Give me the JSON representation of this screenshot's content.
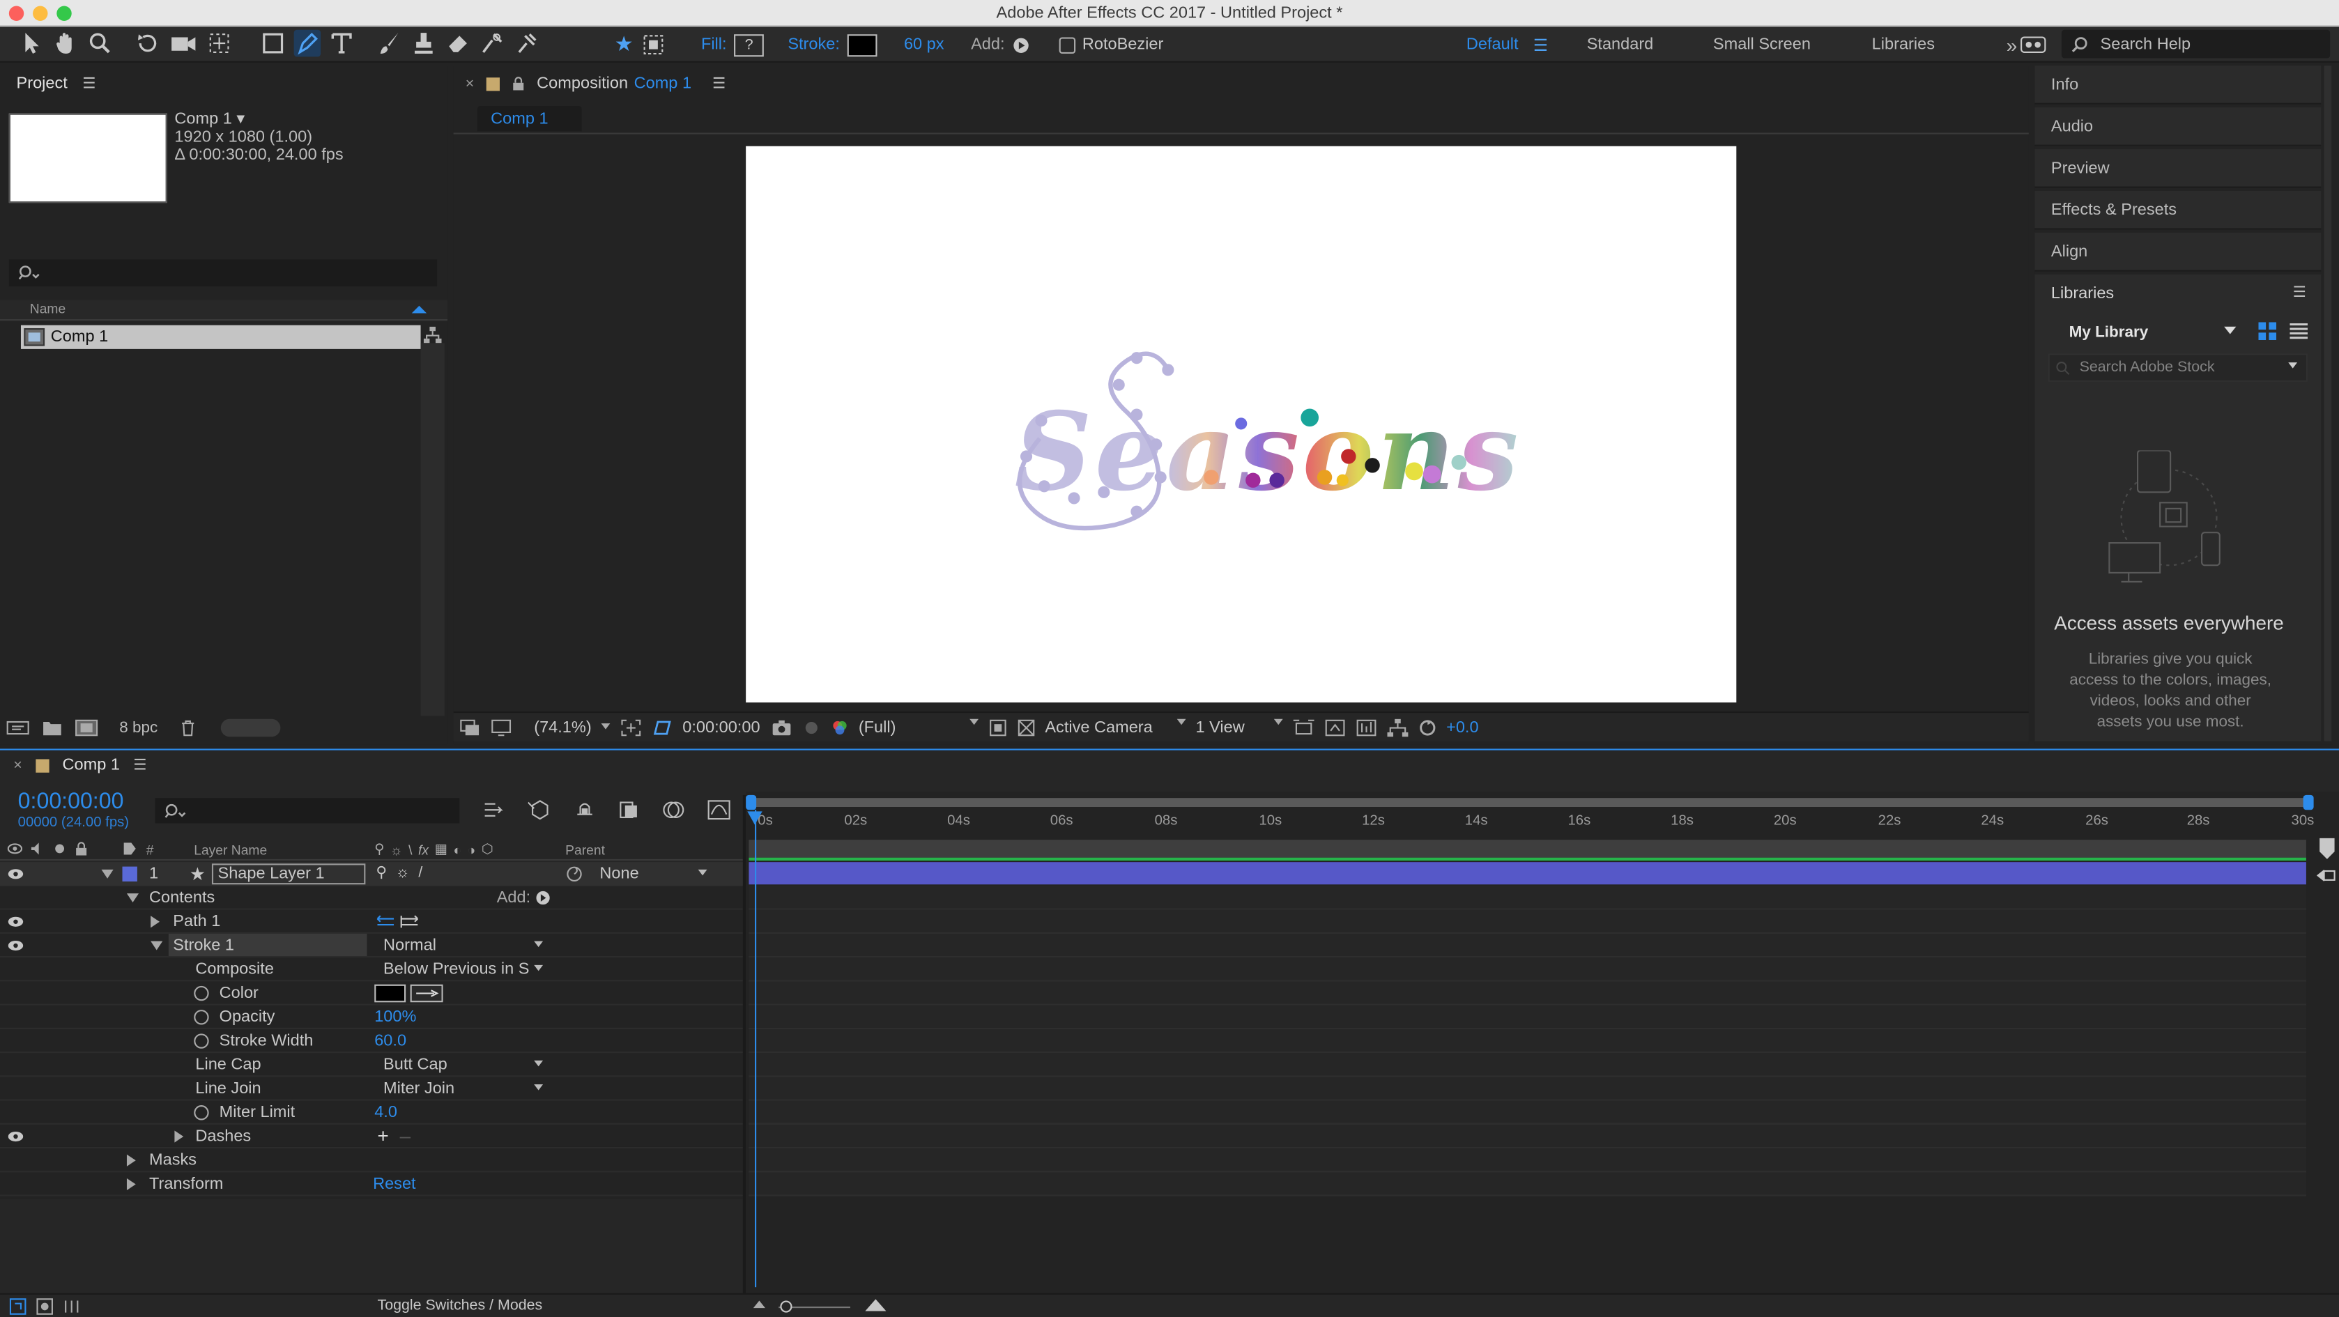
{
  "window": {
    "title": "Adobe After Effects CC 2017 - Untitled Project *"
  },
  "toolbar": {
    "fill_label": "Fill:",
    "stroke_label": "Stroke:",
    "stroke_width": "60 px",
    "add_label": "Add:",
    "rotobezier_label": "RotoBezier",
    "workspaces": [
      "Default",
      "Standard",
      "Small Screen",
      "Libraries"
    ],
    "search_placeholder": "Search Help"
  },
  "project": {
    "panel_title": "Project",
    "comp_name": "Comp 1 ▾",
    "comp_dims": "1920 x 1080 (1.00)",
    "comp_duration": "Δ 0:00:30:00, 24.00 fps",
    "column_name": "Name",
    "items": [
      {
        "name": "Comp 1"
      }
    ],
    "bpc": "8 bpc"
  },
  "composition": {
    "panel_prefix": "Composition",
    "panel_name": "Comp 1",
    "tab": "Comp 1",
    "artwork_text": "Seasons",
    "zoom": "(74.1%)",
    "timecode": "0:00:00:00",
    "resolution": "(Full)",
    "camera": "Active Camera",
    "view": "1 View",
    "exposure": "+0.0"
  },
  "sidebar": {
    "items": [
      "Info",
      "Audio",
      "Preview",
      "Effects & Presets",
      "Align",
      "Libraries"
    ],
    "library_select": "My Library",
    "stock_placeholder": "Search Adobe Stock",
    "headline": "Access assets everywhere",
    "body": "Libraries give you quick access to the colors, images, videos, looks and other assets you use most."
  },
  "timeline": {
    "tab": "Comp 1",
    "timecode": "0:00:00:00",
    "timecode_sub": "00000 (24.00 fps)",
    "columns": {
      "num": "#",
      "layer_name": "Layer Name",
      "parent": "Parent"
    },
    "ruler": [
      "0s",
      "02s",
      "04s",
      "06s",
      "08s",
      "10s",
      "12s",
      "14s",
      "16s",
      "18s",
      "20s",
      "22s",
      "24s",
      "26s",
      "28s",
      "30s"
    ],
    "layer": {
      "num": "1",
      "name": "Shape Layer 1",
      "parent": "None"
    },
    "props": {
      "contents": "Contents",
      "add": "Add:",
      "path": "Path 1",
      "stroke": "Stroke 1",
      "stroke_mode": "Normal",
      "composite_label": "Composite",
      "composite_value": "Below Previous in Sa",
      "color_label": "Color",
      "opacity_label": "Opacity",
      "opacity_value": "100%",
      "stroke_width_label": "Stroke Width",
      "stroke_width_value": "60.0",
      "line_cap_label": "Line Cap",
      "line_cap_value": "Butt Cap",
      "line_join_label": "Line Join",
      "line_join_value": "Miter Join",
      "miter_limit_label": "Miter Limit",
      "miter_limit_value": "4.0",
      "dashes_label": "Dashes",
      "masks_label": "Masks",
      "transform_label": "Transform",
      "reset_label": "Reset"
    },
    "toggle_label": "Toggle Switches / Modes"
  },
  "colors": {
    "accent": "#2d8ceb",
    "layer_bar": "#5658c8",
    "bg": "#232323",
    "panel": "#2a2a2a"
  }
}
